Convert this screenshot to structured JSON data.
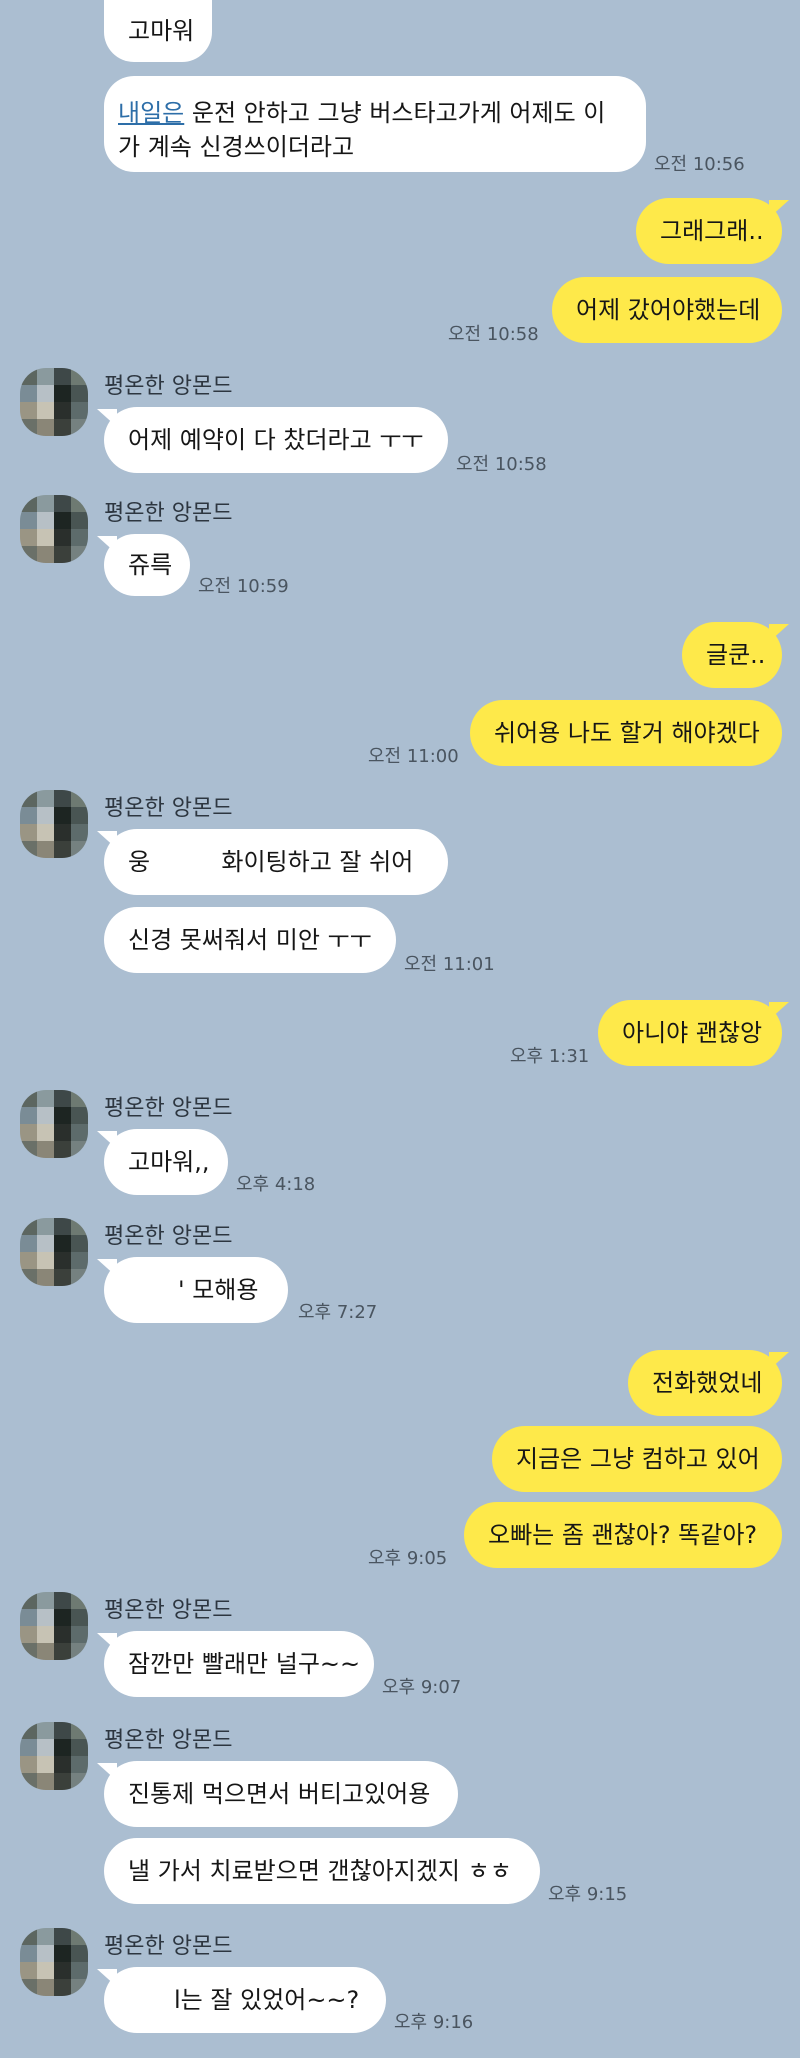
{
  "contact_name": "평온한 앙몬드",
  "messages": {
    "m1": "고마워",
    "m2_link": "내일은",
    "m2_rest": " 운전 안하고 그냥 버스타고가게 어제도 이가 계속 신경쓰이더라고",
    "m3": "그래그래..",
    "m4": "어제 갔어야했는데",
    "m5": "어제 예약이 다 찼더라고 ㅜㅜ",
    "m6": "쥬륵",
    "m7": "글쿤..",
    "m8": "쉬어용 나도 할거 해야겠다",
    "m9a": "웅",
    "m9b": "화이팅하고 잘 쉬어",
    "m10": "신경 못써줘서 미안 ㅜㅜ",
    "m11": "아니야 괜찮앙",
    "m12": "고마워,,",
    "m13": "' 모해용",
    "m14": "전화했었네",
    "m15": "지금은 그냥 컴하고 있어",
    "m16": "오빠는 좀 괜찮아? 똑같아?",
    "m17": "잠깐만 빨래만 널구~~",
    "m18": "진통제 먹으면서 버티고있어용",
    "m19": "낼 가서 치료받으면 갠찮아지겠지 ㅎㅎ",
    "m20": "l는 잘 있었어~~?"
  },
  "times": {
    "t1": "오전 10:56",
    "t2": "오전 10:58",
    "t3": "오전 10:58",
    "t4": "오전 10:59",
    "t5": "오전 11:00",
    "t6": "오전 11:01",
    "t7": "오후 1:31",
    "t8": "오후 4:18",
    "t9": "오후 7:27",
    "t10": "오후 9:05",
    "t11": "오후 9:07",
    "t12": "오후 9:15",
    "t13": "오후 9:16"
  }
}
